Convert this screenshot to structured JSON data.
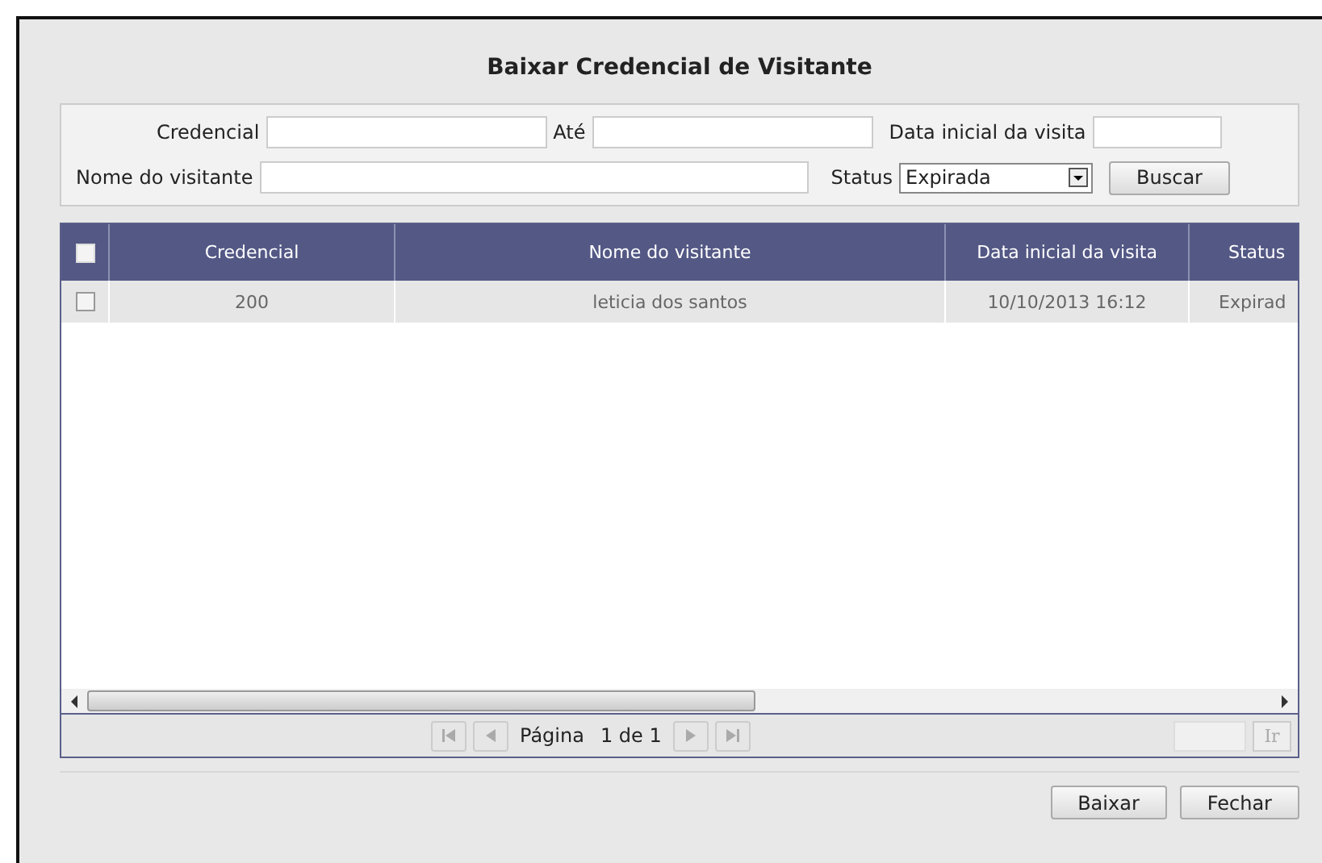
{
  "dialog": {
    "title": "Baixar Credencial de Visitante"
  },
  "filters": {
    "credencial": {
      "label": "Credencial"
    },
    "ate": {
      "label": "Até"
    },
    "data_inicial": {
      "label": "Data inicial da visita"
    },
    "nome": {
      "label": "Nome do visitante"
    },
    "status": {
      "label": "Status",
      "value": "Expirada"
    },
    "search_button": "Buscar"
  },
  "table": {
    "select_all_checked": false,
    "columns": [
      "Credencial",
      "Nome do visitante",
      "Data inicial da visita",
      "Status"
    ],
    "rows": [
      {
        "checked": false,
        "cells": [
          "200",
          "leticia dos santos",
          "10/10/2013 16:12",
          "Expirad"
        ]
      }
    ]
  },
  "pager": {
    "label": "Página",
    "info": "1 de 1",
    "go_button": "Ir"
  },
  "buttons": [
    "Baixar",
    "Fechar"
  ]
}
